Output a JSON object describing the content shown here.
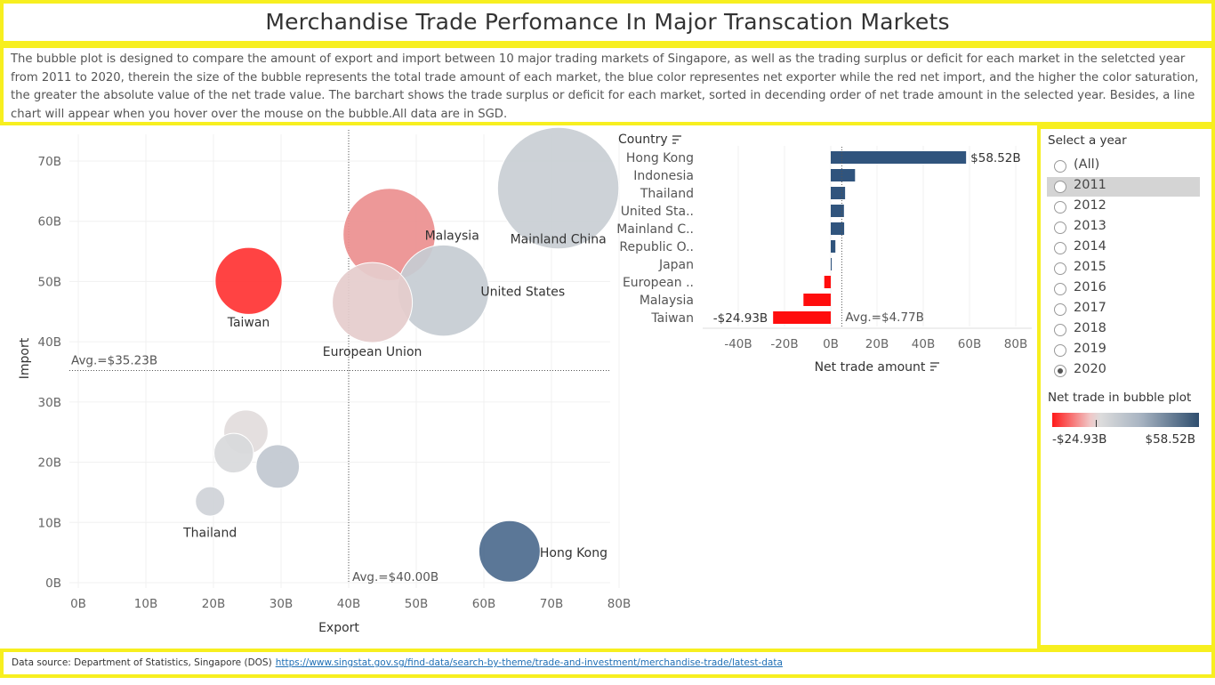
{
  "title": "Merchandise Trade Perfomance In Major Transcation Markets",
  "description": "The bubble plot is designed to compare the amount of export and import between 10 major trading markets of Singapore, as well as the trading surplus or deficit for each market in the seletcted year from 2011 to 2020, therein the size of the bubble represents the total trade amount of each market, the blue color representes net exporter while the red net import, and the higher the color saturation, the greater the absolute value of the net trade value. The barchart shows the trade surplus or deficit for each market, sorted in decending order of net trade amount in the selected year. Besides, a line chart will appear when you hover over the mouse on the bubble.All data are in SGD.",
  "source": {
    "label": "Data source: Department of Statistics, Singapore (DOS)",
    "url": "https://www.singstat.gov.sg/find-data/search-by-theme/trade-and-investment/merchandise-trade/latest-data"
  },
  "filter": {
    "title": "Select a year",
    "options": [
      "(All)",
      "2011",
      "2012",
      "2013",
      "2014",
      "2015",
      "2016",
      "2017",
      "2018",
      "2019",
      "2020"
    ],
    "highlighted": "2011",
    "selected": "2020"
  },
  "legend": {
    "title": "Net trade in bubble plot",
    "min_label": "-$24.93B",
    "max_label": "$58.52B",
    "colors": {
      "negative": "#ff1a1a",
      "neutral": "#dcdcdc",
      "positive": "#2f4e6e"
    }
  },
  "chart_data": [
    {
      "type": "scatter",
      "xlabel": "Export",
      "ylabel": "Import",
      "xlim": [
        0,
        80
      ],
      "ylim": [
        0,
        70
      ],
      "x_ticks": [
        "0B",
        "10B",
        "20B",
        "30B",
        "40B",
        "50B",
        "60B",
        "70B",
        "80B"
      ],
      "y_ticks": [
        "0B",
        "10B",
        "20B",
        "30B",
        "40B",
        "50B",
        "60B",
        "70B"
      ],
      "x_ref": {
        "value": 40.0,
        "label": "Avg.=$40.00B"
      },
      "y_ref": {
        "value": 35.23,
        "label": "Avg.=$35.23B"
      },
      "points": [
        {
          "label": "Mainland China",
          "x": 71.0,
          "y": 65.5,
          "size": 136.5,
          "color": "#c9ced4"
        },
        {
          "label": "Malaysia",
          "x": 46.0,
          "y": 57.8,
          "size": 103.8,
          "color": "#ec8f8f"
        },
        {
          "label": "United States",
          "x": 54.0,
          "y": 48.5,
          "size": 102.5,
          "color": "#c6ccd3"
        },
        {
          "label": "European Union",
          "x": 43.5,
          "y": 46.5,
          "size": 90.0,
          "color": "#e5cccc"
        },
        {
          "label": "Taiwan",
          "x": 25.2,
          "y": 50.1,
          "size": 75.3,
          "color": "#ff3333"
        },
        {
          "label": "",
          "x": 24.8,
          "y": 25.0,
          "size": 49.8,
          "color": "#e2dcdc"
        },
        {
          "label": "",
          "x": 23.0,
          "y": 21.5,
          "size": 44.5,
          "color": "#d8d9db"
        },
        {
          "label": "",
          "x": 29.5,
          "y": 19.3,
          "size": 48.8,
          "color": "#c1c8d0"
        },
        {
          "label": "Thailand",
          "x": 19.5,
          "y": 13.5,
          "size": 33.0,
          "color": "#cfd3d8"
        },
        {
          "label": "Hong Kong",
          "x": 63.8,
          "y": 5.2,
          "size": 69.0,
          "color": "#4d6b8e"
        }
      ]
    },
    {
      "type": "bar",
      "orientation": "horizontal",
      "category_header": "Country",
      "xlabel": "Net trade amount",
      "xlim": [
        -50,
        85
      ],
      "x_ticks": [
        "-40B",
        "-20B",
        "0B",
        "20B",
        "40B",
        "60B",
        "80B"
      ],
      "x_tick_values": [
        -40,
        -20,
        0,
        20,
        40,
        60,
        80
      ],
      "ref": {
        "value": 4.77,
        "label": "Avg.=$4.77B"
      },
      "categories": [
        "Hong Kong",
        "Indonesia",
        "Thailand",
        "United Sta..",
        "Mainland C..",
        "Republic O..",
        "Japan",
        "European ..",
        "Malaysia",
        "Taiwan"
      ],
      "values": [
        58.52,
        10.5,
        6.2,
        5.7,
        5.8,
        2.0,
        0.4,
        -2.8,
        -11.8,
        -24.93
      ],
      "value_labels": {
        "0": "$58.52B",
        "9": "-$24.93B"
      },
      "colors": {
        "positive": "#30547d",
        "negative": "#ff0d0d"
      }
    }
  ]
}
